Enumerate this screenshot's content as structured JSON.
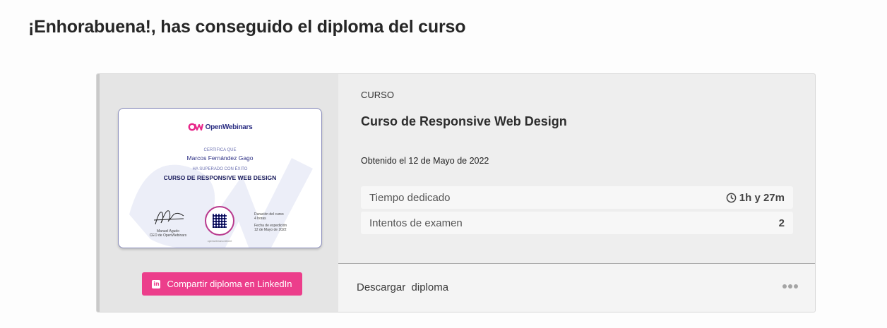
{
  "page": {
    "title": "¡Enhorabuena!, has conseguido el diploma del curso"
  },
  "diploma": {
    "logo_text": "OpenWebinars",
    "certifies_label": "CERTIFICA QUE",
    "recipient": "Marcos Fernández Gago",
    "passed_label": "HA SUPERADO CON ÉXITO",
    "course_name": "CURSO DE RESPONSIVE WEB DESIGN",
    "signer_name": "Manuel Agudo",
    "signer_role": "CEO de OpenWebinars",
    "duration_label": "Duración del curso",
    "duration_value": "4 horas",
    "issue_label": "Fecha de expedición",
    "issue_value": "12 de Mayo de 2022",
    "brand_color": "#2b2e83",
    "accent_color": "#e8288b"
  },
  "share": {
    "linkedin_label": "Compartir diploma en LinkedIn",
    "icon": "linkedin-icon",
    "color": "#ec3e8b"
  },
  "course": {
    "kicker": "CURSO",
    "title": "Curso de Responsive Web Design",
    "obtained": "Obtenido el 12 de Mayo de 2022"
  },
  "stats": [
    {
      "label": "Tiempo dedicado",
      "value": "1h y 27m",
      "icon": "clock-icon"
    },
    {
      "label": "Intentos de examen",
      "value": "2"
    }
  ],
  "download": {
    "label": "Descargar  diploma",
    "more_icon": "more-options-icon"
  }
}
